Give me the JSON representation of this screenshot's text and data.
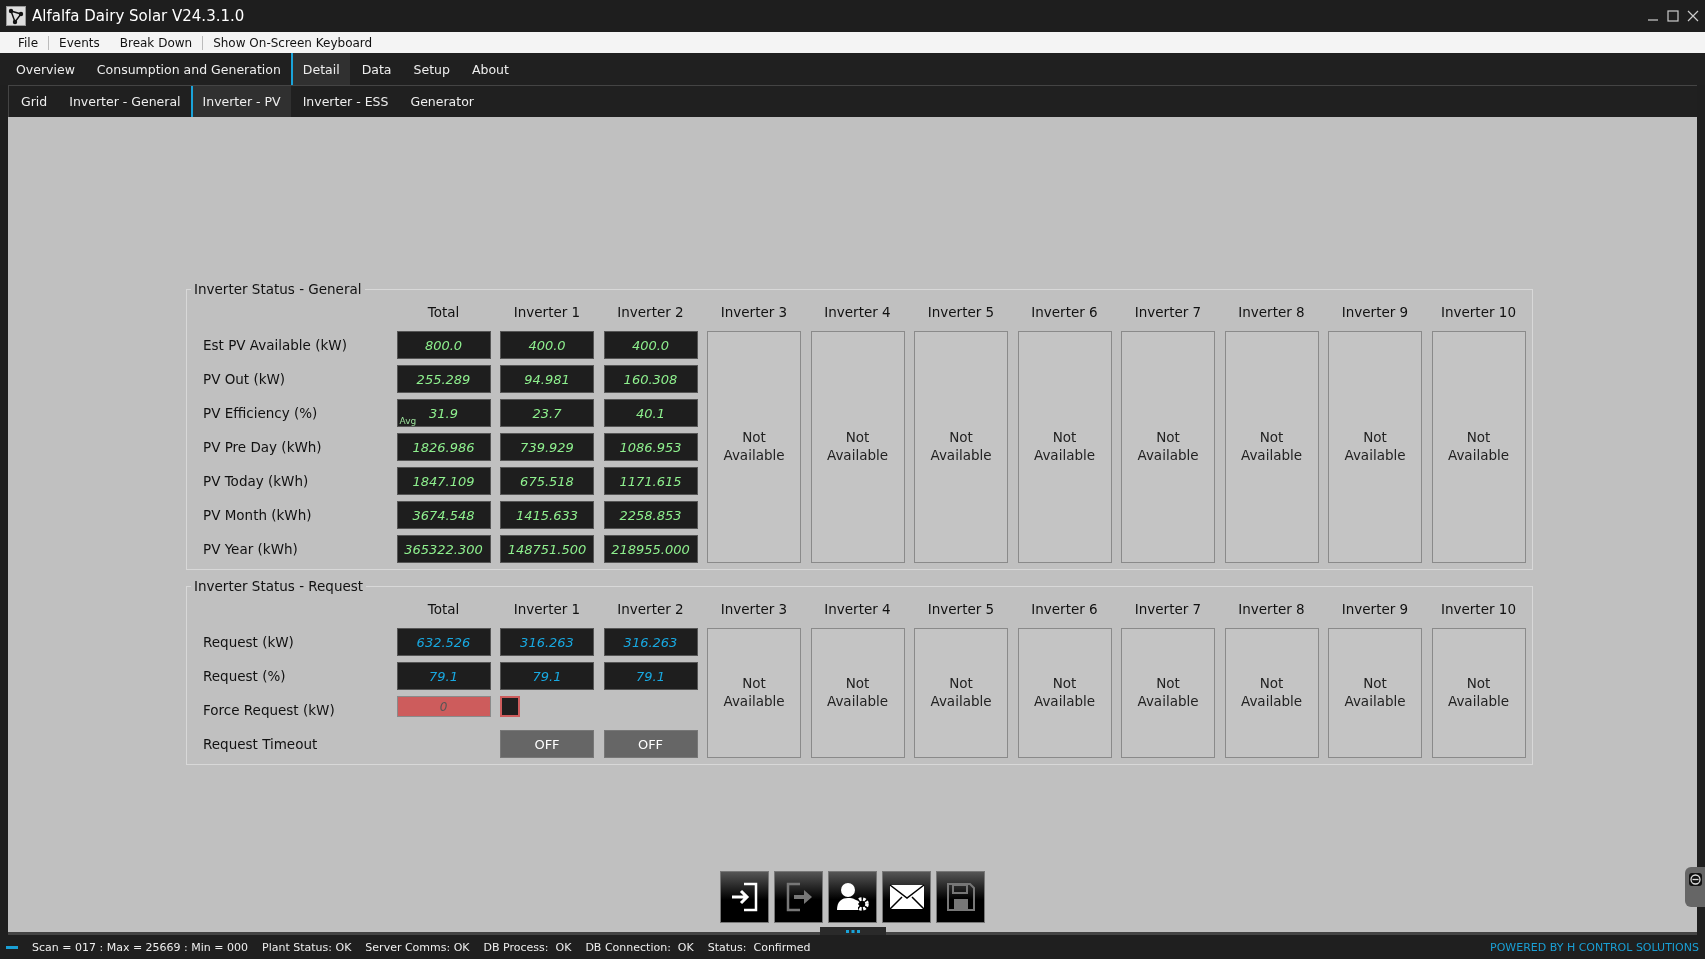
{
  "window": {
    "title": "Alfalfa Dairy Solar V24.3.1.0"
  },
  "menu": [
    "File",
    "Events",
    "Break Down",
    "Show On-Screen Keyboard"
  ],
  "tabs": [
    {
      "label": "Overview",
      "selected": false
    },
    {
      "label": "Consumption and Generation",
      "selected": false
    },
    {
      "label": "Detail",
      "selected": true
    },
    {
      "label": "Data",
      "selected": false
    },
    {
      "label": "Setup",
      "selected": false
    },
    {
      "label": "About",
      "selected": false
    }
  ],
  "subtabs": [
    {
      "label": "Grid",
      "selected": false
    },
    {
      "label": "Inverter - General",
      "selected": false
    },
    {
      "label": "Inverter - PV",
      "selected": true
    },
    {
      "label": "Inverter - ESS",
      "selected": false
    },
    {
      "label": "Generator",
      "selected": false
    }
  ],
  "sections": [
    {
      "title": "Inverter Status - General",
      "kind": "output",
      "columns": [
        "Total",
        "Inverter 1",
        "Inverter 2",
        "Inverter 3",
        "Inverter 4",
        "Inverter 5",
        "Inverter 6",
        "Inverter 7",
        "Inverter 8",
        "Inverter 9",
        "Inverter 10"
      ],
      "rows": [
        {
          "label": "Est PV Available (kW)",
          "kind": "values",
          "cells": [
            {
              "text": "800.0"
            },
            {
              "text": "400.0"
            },
            {
              "text": "400.0"
            }
          ]
        },
        {
          "label": "PV Out (kW)",
          "kind": "values",
          "cells": [
            {
              "text": "255.289"
            },
            {
              "text": "94.981"
            },
            {
              "text": "160.308"
            }
          ]
        },
        {
          "label": "PV Efficiency (%)",
          "kind": "values",
          "cells": [
            {
              "text": "31.9",
              "badge": "Avg"
            },
            {
              "text": "23.7"
            },
            {
              "text": "40.1"
            }
          ]
        },
        {
          "label": "PV Pre Day (kWh)",
          "kind": "values",
          "cells": [
            {
              "text": "1826.986"
            },
            {
              "text": "739.929"
            },
            {
              "text": "1086.953"
            }
          ]
        },
        {
          "label": "PV Today (kWh)",
          "kind": "values",
          "cells": [
            {
              "text": "1847.109"
            },
            {
              "text": "675.518"
            },
            {
              "text": "1171.615"
            }
          ]
        },
        {
          "label": "PV Month (kWh)",
          "kind": "values",
          "cells": [
            {
              "text": "3674.548"
            },
            {
              "text": "1415.633"
            },
            {
              "text": "2258.853"
            }
          ]
        },
        {
          "label": "PV Year (kWh)",
          "kind": "values",
          "cells": [
            {
              "text": "365322.300"
            },
            {
              "text": "148751.500"
            },
            {
              "text": "218955.000"
            }
          ]
        }
      ],
      "unavailable": [
        "Not Available",
        "Not Available",
        "Not Available",
        "Not Available",
        "Not Available",
        "Not Available",
        "Not Available",
        "Not Available"
      ]
    },
    {
      "title": "Inverter Status - Request",
      "kind": "request",
      "columns": [
        "Total",
        "Inverter 1",
        "Inverter 2",
        "Inverter 3",
        "Inverter 4",
        "Inverter 5",
        "Inverter 6",
        "Inverter 7",
        "Inverter 8",
        "Inverter 9",
        "Inverter 10"
      ],
      "rows": [
        {
          "label": "Request (kW)",
          "kind": "values",
          "cells": [
            {
              "text": "632.526"
            },
            {
              "text": "316.263"
            },
            {
              "text": "316.263"
            }
          ]
        },
        {
          "label": "Request (%)",
          "kind": "values",
          "cells": [
            {
              "text": "79.1"
            },
            {
              "text": "79.1"
            },
            {
              "text": "79.1"
            }
          ]
        },
        {
          "label": "Force Request (kW)",
          "kind": "force",
          "input": "0",
          "checked": false
        },
        {
          "label": "Request Timeout",
          "kind": "toggles",
          "toggles": [
            "OFF",
            "OFF"
          ]
        }
      ],
      "unavailable": [
        "Not Available",
        "Not Available",
        "Not Available",
        "Not Available",
        "Not Available",
        "Not Available",
        "Not Available",
        "Not Available"
      ]
    }
  ],
  "toolbar": [
    {
      "kind": "login",
      "disabled": false
    },
    {
      "kind": "logout",
      "disabled": true
    },
    {
      "kind": "user-settings",
      "disabled": false
    },
    {
      "kind": "mail",
      "disabled": false
    },
    {
      "kind": "save",
      "disabled": true
    }
  ],
  "status_bar": {
    "items": [
      "Scan = 017 : Max = 25669 : Min = 000",
      "Plant Status: OK",
      "Server Comms: OK",
      "DB Process:  OK",
      "DB Connection:  OK",
      "Status:  Confirmed"
    ],
    "credit": "POWERED BY H CONTROL SOLUTIONS"
  }
}
